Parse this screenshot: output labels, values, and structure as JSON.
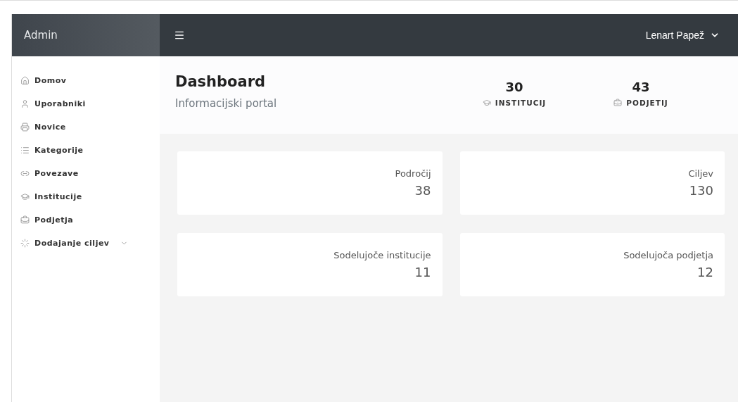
{
  "brand": "Admin",
  "user": {
    "name": "Lenart Papež"
  },
  "sidebar": {
    "items": [
      {
        "label": "Domov",
        "expandable": false
      },
      {
        "label": "Uporabniki",
        "expandable": false
      },
      {
        "label": "Novice",
        "expandable": false
      },
      {
        "label": "Kategorije",
        "expandable": false
      },
      {
        "label": "Povezave",
        "expandable": false
      },
      {
        "label": "Institucije",
        "expandable": false
      },
      {
        "label": "Podjetja",
        "expandable": false
      },
      {
        "label": "Dodajanje ciljev",
        "expandable": true
      }
    ]
  },
  "page": {
    "title": "Dashboard",
    "subtitle": "Informacijski portal"
  },
  "stats": [
    {
      "value": "30",
      "label": "INSTITUCIJ"
    },
    {
      "value": "43",
      "label": "PODJETIJ"
    }
  ],
  "cards": [
    {
      "label": "Področij",
      "value": "38"
    },
    {
      "label": "Ciljev",
      "value": "130"
    },
    {
      "label": "Sodelujoče institucije",
      "value": "11"
    },
    {
      "label": "Sodelujoča podjetja",
      "value": "12"
    }
  ]
}
